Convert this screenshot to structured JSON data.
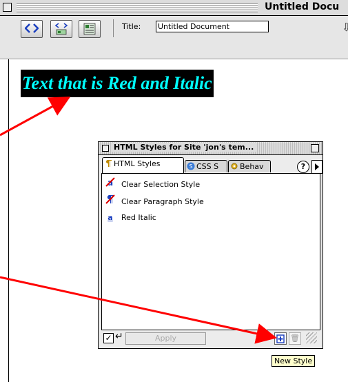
{
  "window": {
    "title": "Untitled Docu"
  },
  "toolbar": {
    "title_label": "Title:",
    "title_value": "Untitled Document",
    "buttons": [
      "code-view-icon",
      "split-view-icon",
      "design-view-icon"
    ]
  },
  "document": {
    "styled_text": "Text that is Red and Italic"
  },
  "palette": {
    "title": "HTML Styles for Site 'jon's tem...",
    "tabs": [
      {
        "label": "HTML Styles",
        "icon": "html-styles-icon",
        "active": true
      },
      {
        "label": "CSS S",
        "icon": "css-styles-icon",
        "active": false
      },
      {
        "label": "Behav",
        "icon": "behaviors-icon",
        "active": false
      }
    ],
    "help": "?",
    "items": [
      {
        "label": "Clear Selection Style",
        "icon": "clear-selection-icon"
      },
      {
        "label": "Clear Paragraph Style",
        "icon": "clear-paragraph-icon"
      },
      {
        "label": "Red Italic",
        "icon": "style-a-icon",
        "glyph": "a"
      }
    ],
    "apply_label": "Apply",
    "apply_checked": true
  },
  "tooltip": "New Style",
  "colors": {
    "annotation_arrow": "#ff0000",
    "styled_text_fg": "#00ffff",
    "styled_text_bg": "#000000"
  }
}
